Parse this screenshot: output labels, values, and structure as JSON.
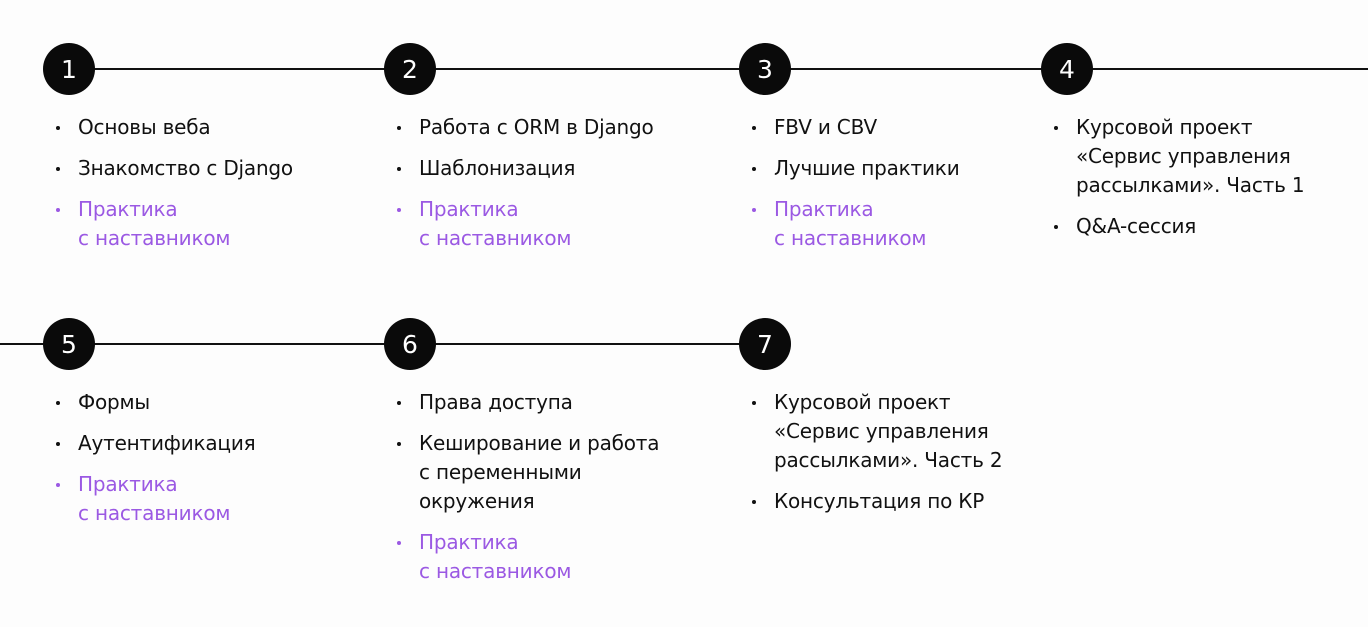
{
  "accent_color": "#9b59e3",
  "steps": [
    {
      "number": "1",
      "items": [
        {
          "text": "Основы веба",
          "practice": false
        },
        {
          "text": "Знакомство с Django",
          "practice": false
        },
        {
          "text": "Практика\nс наставником",
          "practice": true
        }
      ]
    },
    {
      "number": "2",
      "items": [
        {
          "text": "Работа с ORM в Django",
          "practice": false
        },
        {
          "text": "Шаблонизация",
          "practice": false
        },
        {
          "text": "Практика\nс наставником",
          "practice": true
        }
      ]
    },
    {
      "number": "3",
      "items": [
        {
          "text": "FBV и CBV",
          "practice": false
        },
        {
          "text": "Лучшие практики",
          "practice": false
        },
        {
          "text": "Практика\nс наставником",
          "practice": true
        }
      ]
    },
    {
      "number": "4",
      "items": [
        {
          "text": "Курсовой проект\n«Сервис управления\nрассылками». Часть 1",
          "practice": false
        },
        {
          "text": "Q&A-сессия",
          "practice": false
        }
      ]
    },
    {
      "number": "5",
      "items": [
        {
          "text": "Формы",
          "practice": false
        },
        {
          "text": "Аутентификация",
          "practice": false
        },
        {
          "text": "Практика\nс наставником",
          "practice": true
        }
      ]
    },
    {
      "number": "6",
      "items": [
        {
          "text": "Права доступа",
          "practice": false
        },
        {
          "text": "Кеширование и работа\nс переменными\nокружения",
          "practice": false
        },
        {
          "text": "Практика\nс наставником",
          "practice": true
        }
      ]
    },
    {
      "number": "7",
      "items": [
        {
          "text": "Курсовой проект\n«Сервис управления\nрассылками». Часть 2",
          "practice": false
        },
        {
          "text": "Консультация по КР",
          "practice": false
        }
      ]
    }
  ]
}
